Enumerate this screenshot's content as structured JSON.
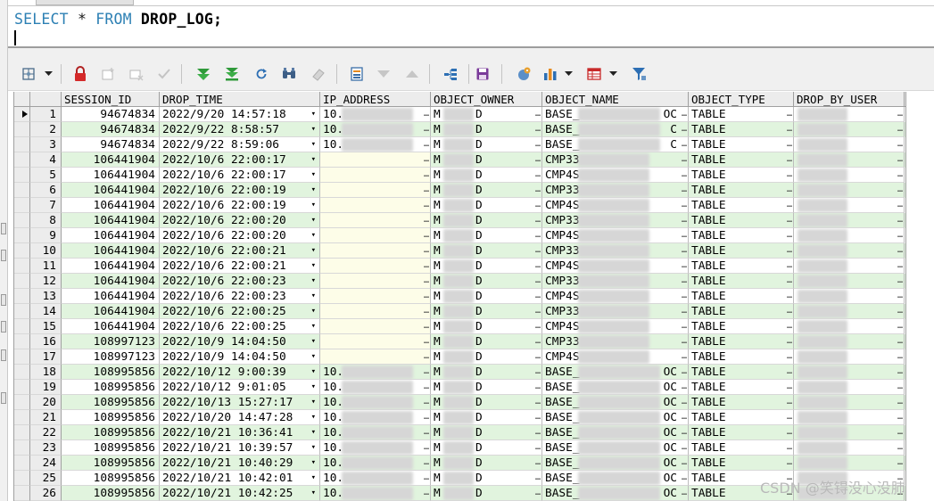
{
  "editor": {
    "sql_keyword_select": "SELECT",
    "sql_star": "*",
    "sql_keyword_from": "FROM",
    "sql_table": "DROP_LOG;"
  },
  "toolbar": {
    "icons": [
      "grid-options-icon",
      "dropdown-caret-icon",
      "lock-icon",
      "insert-record-icon",
      "delete-record-icon",
      "post-changes-icon",
      "fetch-next-icon",
      "fetch-last-icon",
      "refresh-icon",
      "find-icon",
      "clear-icon",
      "single-record-view-icon",
      "query-by-example-icon",
      "previous-record-icon",
      "export-query-results-icon",
      "save-icon",
      "print-icon",
      "chart-icon",
      "dropdown-caret-icon",
      "export-icon",
      "dropdown-caret-icon",
      "filter-icon"
    ]
  },
  "grid": {
    "columns": [
      "",
      "",
      "SESSION_ID",
      "DROP_TIME",
      "IP_ADDRESS",
      "OBJECT_OWNER",
      "OBJECT_NAME",
      "OBJECT_TYPE",
      "DROP_BY_USER"
    ],
    "colors": {
      "even_row": "#e1f4de",
      "odd_row": "#ffffff",
      "header": "#ececec",
      "keyword": "#2d80b4"
    },
    "rows": [
      {
        "n": "1",
        "session_id": "94674834",
        "drop_time": "2022/9/20 14:57:18",
        "ip": "10.",
        "owner_a": "M",
        "owner_b": "D",
        "name_a": "BASE_",
        "name_b": "OC",
        "type": "TABLE"
      },
      {
        "n": "2",
        "session_id": "94674834",
        "drop_time": "2022/9/22 8:58:57",
        "ip": "10.",
        "owner_a": "M",
        "owner_b": "D",
        "name_a": "BASE_",
        "name_b": "C",
        "type": "TABLE"
      },
      {
        "n": "3",
        "session_id": "94674834",
        "drop_time": "2022/9/22 8:59:06",
        "ip": "10.",
        "owner_a": "M",
        "owner_b": "D",
        "name_a": "BASE_",
        "name_b": "C",
        "type": "TABLE"
      },
      {
        "n": "4",
        "session_id": "106441904",
        "drop_time": "2022/10/6 22:00:17",
        "ip": "",
        "owner_a": "M",
        "owner_b": "D",
        "name_a": "CMP33",
        "name_b": "",
        "type": "TABLE"
      },
      {
        "n": "5",
        "session_id": "106441904",
        "drop_time": "2022/10/6 22:00:17",
        "ip": "",
        "owner_a": "M",
        "owner_b": "D",
        "name_a": "CMP4S",
        "name_b": "",
        "type": "TABLE"
      },
      {
        "n": "6",
        "session_id": "106441904",
        "drop_time": "2022/10/6 22:00:19",
        "ip": "",
        "owner_a": "M",
        "owner_b": "D",
        "name_a": "CMP33",
        "name_b": "",
        "type": "TABLE"
      },
      {
        "n": "7",
        "session_id": "106441904",
        "drop_time": "2022/10/6 22:00:19",
        "ip": "",
        "owner_a": "M",
        "owner_b": "D",
        "name_a": "CMP4S",
        "name_b": "",
        "type": "TABLE"
      },
      {
        "n": "8",
        "session_id": "106441904",
        "drop_time": "2022/10/6 22:00:20",
        "ip": "",
        "owner_a": "M",
        "owner_b": "D",
        "name_a": "CMP33",
        "name_b": "",
        "type": "TABLE"
      },
      {
        "n": "9",
        "session_id": "106441904",
        "drop_time": "2022/10/6 22:00:20",
        "ip": "",
        "owner_a": "M",
        "owner_b": "D",
        "name_a": "CMP4S",
        "name_b": "",
        "type": "TABLE"
      },
      {
        "n": "10",
        "session_id": "106441904",
        "drop_time": "2022/10/6 22:00:21",
        "ip": "",
        "owner_a": "M",
        "owner_b": "D",
        "name_a": "CMP33",
        "name_b": "",
        "type": "TABLE"
      },
      {
        "n": "11",
        "session_id": "106441904",
        "drop_time": "2022/10/6 22:00:21",
        "ip": "",
        "owner_a": "M",
        "owner_b": "D",
        "name_a": "CMP4S",
        "name_b": "",
        "type": "TABLE"
      },
      {
        "n": "12",
        "session_id": "106441904",
        "drop_time": "2022/10/6 22:00:23",
        "ip": "",
        "owner_a": "M",
        "owner_b": "D",
        "name_a": "CMP33",
        "name_b": "",
        "type": "TABLE"
      },
      {
        "n": "13",
        "session_id": "106441904",
        "drop_time": "2022/10/6 22:00:23",
        "ip": "",
        "owner_a": "M",
        "owner_b": "D",
        "name_a": "CMP4S",
        "name_b": "",
        "type": "TABLE"
      },
      {
        "n": "14",
        "session_id": "106441904",
        "drop_time": "2022/10/6 22:00:25",
        "ip": "",
        "owner_a": "M",
        "owner_b": "D",
        "name_a": "CMP33",
        "name_b": "",
        "type": "TABLE"
      },
      {
        "n": "15",
        "session_id": "106441904",
        "drop_time": "2022/10/6 22:00:25",
        "ip": "",
        "owner_a": "M",
        "owner_b": "D",
        "name_a": "CMP4S",
        "name_b": "",
        "type": "TABLE"
      },
      {
        "n": "16",
        "session_id": "108997123",
        "drop_time": "2022/10/9 14:04:50",
        "ip": "",
        "owner_a": "M",
        "owner_b": "D",
        "name_a": "CMP33",
        "name_b": "",
        "type": "TABLE"
      },
      {
        "n": "17",
        "session_id": "108997123",
        "drop_time": "2022/10/9 14:04:50",
        "ip": "",
        "owner_a": "M",
        "owner_b": "D",
        "name_a": "CMP4S",
        "name_b": "",
        "type": "TABLE"
      },
      {
        "n": "18",
        "session_id": "108995856",
        "drop_time": "2022/10/12 9:00:39",
        "ip": "10.",
        "owner_a": "M",
        "owner_b": "D",
        "name_a": "BASE_",
        "name_b": "OC",
        "type": "TABLE"
      },
      {
        "n": "19",
        "session_id": "108995856",
        "drop_time": "2022/10/12 9:01:05",
        "ip": "10.",
        "owner_a": "M",
        "owner_b": "D",
        "name_a": "BASE_",
        "name_b": "OC",
        "type": "TABLE"
      },
      {
        "n": "20",
        "session_id": "108995856",
        "drop_time": "2022/10/13 15:27:17",
        "ip": "10.",
        "owner_a": "M",
        "owner_b": "D",
        "name_a": "BASE_",
        "name_b": "OC",
        "type": "TABLE"
      },
      {
        "n": "21",
        "session_id": "108995856",
        "drop_time": "2022/10/20 14:47:28",
        "ip": "10.",
        "owner_a": "M",
        "owner_b": "D",
        "name_a": "BASE_",
        "name_b": "OC",
        "type": "TABLE"
      },
      {
        "n": "22",
        "session_id": "108995856",
        "drop_time": "2022/10/21 10:36:41",
        "ip": "10.",
        "owner_a": "M",
        "owner_b": "D",
        "name_a": "BASE_",
        "name_b": "OC",
        "type": "TABLE"
      },
      {
        "n": "23",
        "session_id": "108995856",
        "drop_time": "2022/10/21 10:39:57",
        "ip": "10.",
        "owner_a": "M",
        "owner_b": "D",
        "name_a": "BASE_",
        "name_b": "OC",
        "type": "TABLE"
      },
      {
        "n": "24",
        "session_id": "108995856",
        "drop_time": "2022/10/21 10:40:29",
        "ip": "10.",
        "owner_a": "M",
        "owner_b": "D",
        "name_a": "BASE_",
        "name_b": "OC",
        "type": "TABLE"
      },
      {
        "n": "25",
        "session_id": "108995856",
        "drop_time": "2022/10/21 10:42:01",
        "ip": "10.",
        "owner_a": "M",
        "owner_b": "D",
        "name_a": "BASE_",
        "name_b": "OC",
        "type": "TABLE"
      },
      {
        "n": "26",
        "session_id": "108995856",
        "drop_time": "2022/10/21 10:42:25",
        "ip": "10.",
        "owner_a": "M",
        "owner_b": "D",
        "name_a": "BASE_",
        "name_b": "OC",
        "type": "TABLE"
      }
    ]
  },
  "watermark": {
    "text": "CSDN @笑锝没心没肺"
  }
}
